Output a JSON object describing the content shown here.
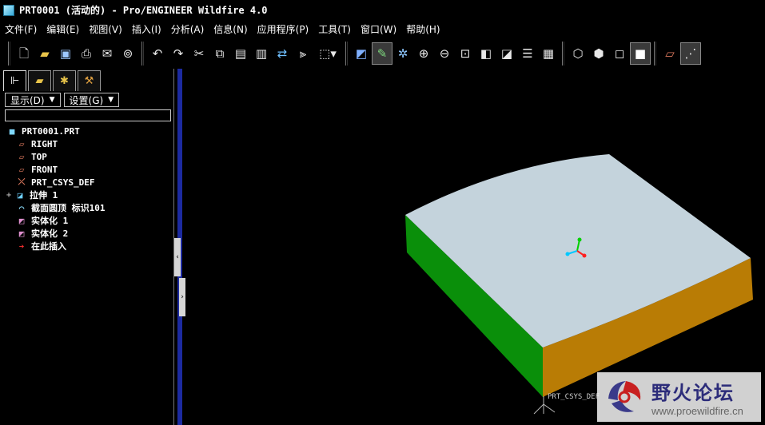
{
  "window": {
    "title": "PRT0001 (活动的) - Pro/ENGINEER Wildfire 4.0"
  },
  "menu": [
    "文件(F)",
    "编辑(E)",
    "视图(V)",
    "插入(I)",
    "分析(A)",
    "信息(N)",
    "应用程序(P)",
    "工具(T)",
    "窗口(W)",
    "帮助(H)"
  ],
  "toolbar": {
    "groups": [
      [
        "new-icon",
        "open-icon",
        "save-icon",
        "print-icon",
        "email-icon",
        "save-copy-icon"
      ],
      [
        "undo-icon",
        "redo-icon",
        "cut-icon",
        "copy-icon",
        "paste-icon",
        "paste-special-icon",
        "regenerate-icon",
        "mirror-icon",
        "select-box-icon"
      ],
      [
        "sketch-icon",
        "datum-icon",
        "spin-center-icon",
        "zoom-in-icon",
        "zoom-out-icon",
        "refit-icon",
        "reorient-icon",
        "saved-views-icon",
        "layers-icon",
        "appearance-icon"
      ],
      [
        "wireframe-icon",
        "hidden-line-icon",
        "no-hidden-icon",
        "shading-icon"
      ],
      [
        "datum-plane-icon",
        "datum-axis-icon"
      ]
    ]
  },
  "left_panel": {
    "tabs": [
      "model-tree-tab",
      "folder-browser-tab",
      "favorites-tab",
      "connections-tab"
    ],
    "display_button": "显示(D)",
    "settings_button": "设置(G)",
    "filter_value": "",
    "tree": [
      {
        "label": "PRT0001.PRT",
        "icon": "part-icon",
        "indent": 0,
        "expander": ""
      },
      {
        "label": "RIGHT",
        "icon": "datum-plane-icon",
        "indent": 1,
        "expander": ""
      },
      {
        "label": "TOP",
        "icon": "datum-plane-icon",
        "indent": 1,
        "expander": ""
      },
      {
        "label": "FRONT",
        "icon": "datum-plane-icon",
        "indent": 1,
        "expander": ""
      },
      {
        "label": "PRT_CSYS_DEF",
        "icon": "csys-icon",
        "indent": 1,
        "expander": ""
      },
      {
        "label": "拉伸 1",
        "icon": "extrude-icon",
        "indent": 1,
        "expander": "+"
      },
      {
        "label": "截面圆顶 标识101",
        "icon": "section-dome-icon",
        "indent": 1,
        "expander": ""
      },
      {
        "label": "实体化 1",
        "icon": "solidify-icon",
        "indent": 1,
        "expander": ""
      },
      {
        "label": "实体化 2",
        "icon": "solidify-icon",
        "indent": 1,
        "expander": ""
      },
      {
        "label": "在此插入",
        "icon": "insert-here-arrow-icon",
        "indent": 1,
        "expander": ""
      }
    ]
  },
  "viewport": {
    "csys_label": "PRT_CSYS_DEF",
    "colors": {
      "top_face": "#c4d3dc",
      "left_face": "#0a8f0a",
      "front_face": "#b97c05",
      "background": "#000000"
    }
  },
  "watermark": {
    "name": "野火论坛",
    "url": "www.proewildfire.cn"
  }
}
